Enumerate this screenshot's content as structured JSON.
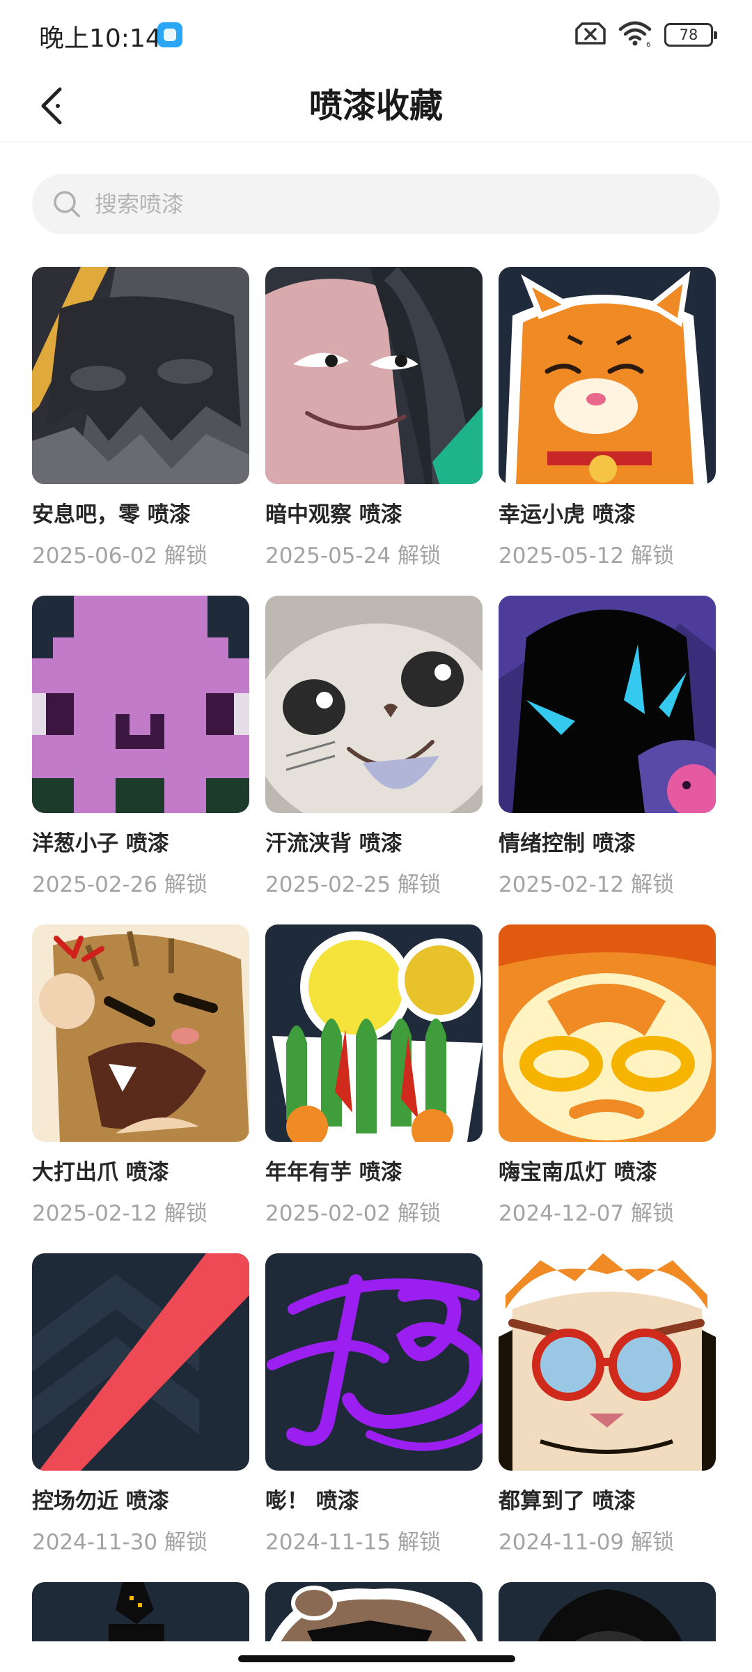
{
  "status_bar": {
    "time": "晚上10:14",
    "battery": "78"
  },
  "header": {
    "title": "喷漆收藏"
  },
  "search": {
    "placeholder": "搜索喷漆"
  },
  "sprays": [
    {
      "name": "安息吧，零 喷漆",
      "date": "2025-06-02 解锁"
    },
    {
      "name": "暗中观察 喷漆",
      "date": "2025-05-24 解锁"
    },
    {
      "name": "幸运小虎 喷漆",
      "date": "2025-05-12 解锁"
    },
    {
      "name": "洋葱小子 喷漆",
      "date": "2025-02-26 解锁"
    },
    {
      "name": "汗流浃背 喷漆",
      "date": "2025-02-25 解锁"
    },
    {
      "name": "情绪控制 喷漆",
      "date": "2025-02-12 解锁"
    },
    {
      "name": "大打出爪 喷漆",
      "date": "2025-02-12 解锁"
    },
    {
      "name": "年年有芋 喷漆",
      "date": "2025-02-02 解锁"
    },
    {
      "name": "嗨宝南瓜灯 喷漆",
      "date": "2024-12-07 解锁"
    },
    {
      "name": "控场勿近 喷漆",
      "date": "2024-11-30 解锁"
    },
    {
      "name": "嘭！ 喷漆",
      "date": "2024-11-15 解锁"
    },
    {
      "name": "都算到了 喷漆",
      "date": "2024-11-09 解锁"
    }
  ],
  "icons": {
    "back": "back-arrow-icon",
    "search": "search-icon",
    "signal": "no-sim-icon",
    "wifi": "wifi-icon"
  }
}
